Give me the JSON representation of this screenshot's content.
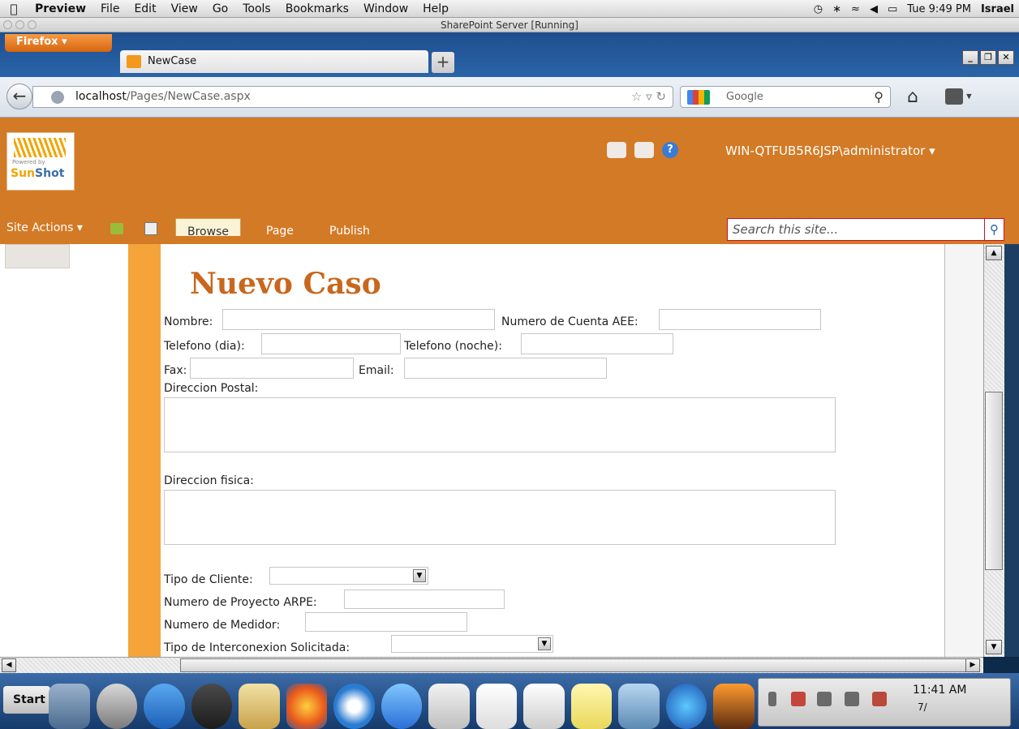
{
  "menubar": {
    "app": "Preview",
    "items": [
      "File",
      "Edit",
      "View",
      "Go",
      "Tools",
      "Bookmarks",
      "Window",
      "Help"
    ],
    "clock": "Tue 9:49 PM",
    "user": "Israel"
  },
  "vm_title": "SharePoint Server [Running]",
  "browser": {
    "menu_button": "Firefox",
    "tab_title": "NewCase",
    "new_tab": "+",
    "url_host": "localhost",
    "url_path": "/Pages/NewCase.aspx",
    "search_engine": "Google"
  },
  "sharepoint": {
    "logo_powered": "Powered by",
    "logo_name_a": "Sun",
    "logo_name_b": "Shot",
    "user": "WIN-QTFUB5R6JSP\\administrator",
    "help": "?",
    "site_actions": "Site Actions",
    "tabs": [
      "Browse",
      "Page",
      "Publish"
    ],
    "search_placeholder": "Search this site..."
  },
  "form": {
    "title": "Nuevo Caso",
    "nombre": "Nombre:",
    "cuenta": "Numero de Cuenta AEE:",
    "tel_dia": "Telefono (dia):",
    "tel_noche": "Telefono (noche):",
    "fax": "Fax:",
    "email": "Email:",
    "dir_postal": "Direccion Postal:",
    "dir_fisica": "Direccion fisica:",
    "tipo_cliente": "Tipo de Cliente:",
    "proyecto": "Numero de Proyecto ARPE:",
    "medidor": "Numero de Medidor:",
    "interconexion": "Tipo de Interconexion Solicitada:"
  },
  "windows": {
    "start": "Start",
    "time": "11:41 AM",
    "date": "7/"
  },
  "colors": {
    "sharepoint_orange": "#d37a26",
    "accent_bar": "#f4a438",
    "title_color": "#c8681e"
  }
}
